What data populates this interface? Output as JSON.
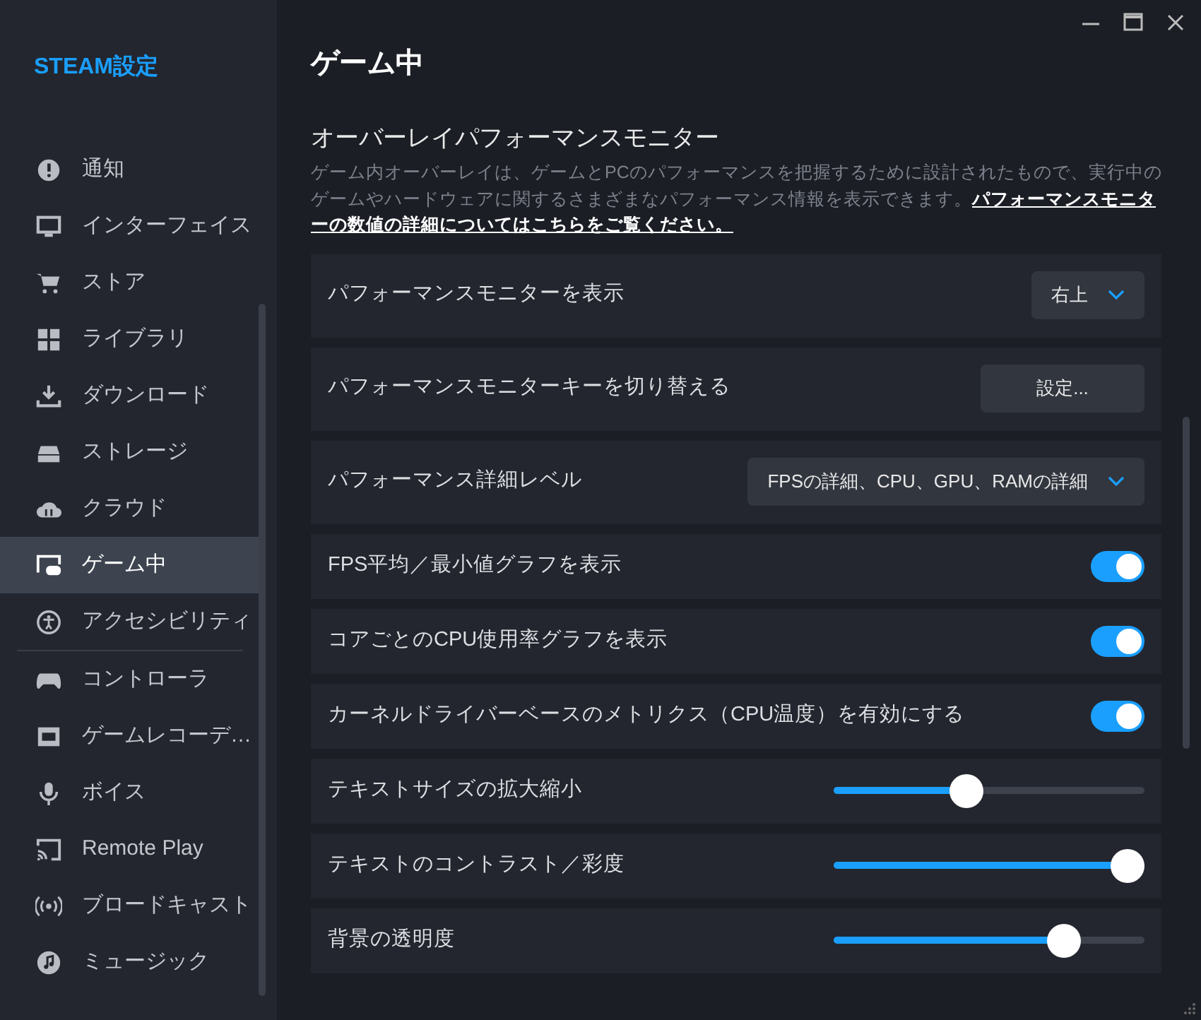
{
  "sidebar": {
    "title": "STEAM設定",
    "items": [
      {
        "label": "通知",
        "selected": false
      },
      {
        "label": "インターフェイス",
        "selected": false
      },
      {
        "label": "ストア",
        "selected": false
      },
      {
        "label": "ライブラリ",
        "selected": false
      },
      {
        "label": "ダウンロード",
        "selected": false
      },
      {
        "label": "ストレージ",
        "selected": false
      },
      {
        "label": "クラウド",
        "selected": false
      },
      {
        "label": "ゲーム中",
        "selected": true
      },
      {
        "label": "アクセシビリティ",
        "selected": false
      },
      {
        "label": "コントローラ",
        "selected": false
      },
      {
        "label": "ゲームレコーデ…",
        "selected": false
      },
      {
        "label": "ボイス",
        "selected": false
      },
      {
        "label": "Remote Play",
        "selected": false
      },
      {
        "label": "ブロードキャスト",
        "selected": false
      },
      {
        "label": "ミュージック",
        "selected": false
      }
    ]
  },
  "page": {
    "title": "ゲーム中",
    "section": {
      "title": "オーバーレイパフォーマンスモニター",
      "description": "ゲーム内オーバーレイは、ゲームとPCのパフォーマンスを把握するために設計されたもので、実行中のゲームやハードウェアに関するさまざまなパフォーマンス情報を表示できます。",
      "link_lines": [
        "パフォーマンスモニタ",
        "ーの数値の詳細についてはこちらをご覧ください。"
      ]
    },
    "settings": [
      {
        "kind": "dropdown",
        "label": "パフォーマンスモニターを表示",
        "value": "右上"
      },
      {
        "kind": "button",
        "label": "パフォーマンスモニターキーを切り替える",
        "value": "設定..."
      },
      {
        "kind": "dropdown",
        "label": "パフォーマンス詳細レベル",
        "value": "FPSの詳細、CPU、GPU、RAMの詳細"
      },
      {
        "kind": "toggle",
        "label": "FPS平均／最小値グラフを表示",
        "on": true
      },
      {
        "kind": "toggle",
        "label": "コアごとのCPU使用率グラフを表示",
        "on": true
      },
      {
        "kind": "toggle",
        "label": "カーネルドライバーベースのメトリクス（CPU温度）を有効にする",
        "on": true
      },
      {
        "kind": "slider",
        "label": "テキストサイズの拡大縮小",
        "level": 0.42
      },
      {
        "kind": "slider",
        "label": "テキストのコントラスト／彩度",
        "level": 1
      },
      {
        "kind": "slider",
        "label": "背景の透明度",
        "level": 0.77
      }
    ]
  }
}
